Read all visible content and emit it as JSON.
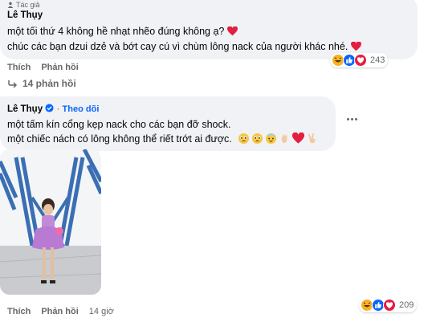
{
  "comment1": {
    "tag": "Tác giả",
    "author": "Lê Thụy",
    "lines": [
      "một tối thứ 4 không hề nhạt nhẽo đúng không ạ?",
      "chúc các bạn dzui dzẻ và bớt cay cú vì chùm lông nack của người khác nhé."
    ],
    "actions": {
      "like": "Thích",
      "reply": "Phản hồi"
    },
    "reaction_count": "243",
    "replies_label": "14 phản hồi"
  },
  "comment2": {
    "author": "Lê Thụy",
    "follow": "Theo dõi",
    "lines": [
      "một tấm kín cổng kẹp nack cho các bạn đỡ shock.",
      "một chiếc nách có lông không thể riết trớt ai được."
    ],
    "actions": {
      "like": "Thích",
      "reply": "Phản hồi",
      "time": "14 giờ"
    },
    "reaction_count": "209"
  },
  "colors": {
    "bubble": "#f0f2f5",
    "link": "#0866ff",
    "muted": "#65676b",
    "heart": "#e41e3f",
    "haha": "#f7b125",
    "like": "#0866ff"
  },
  "icons": [
    "person-icon",
    "heart-icon",
    "haha-icon",
    "like-icon",
    "reply-arrow-icon",
    "verified-icon",
    "more-dots-icon",
    "photo"
  ]
}
